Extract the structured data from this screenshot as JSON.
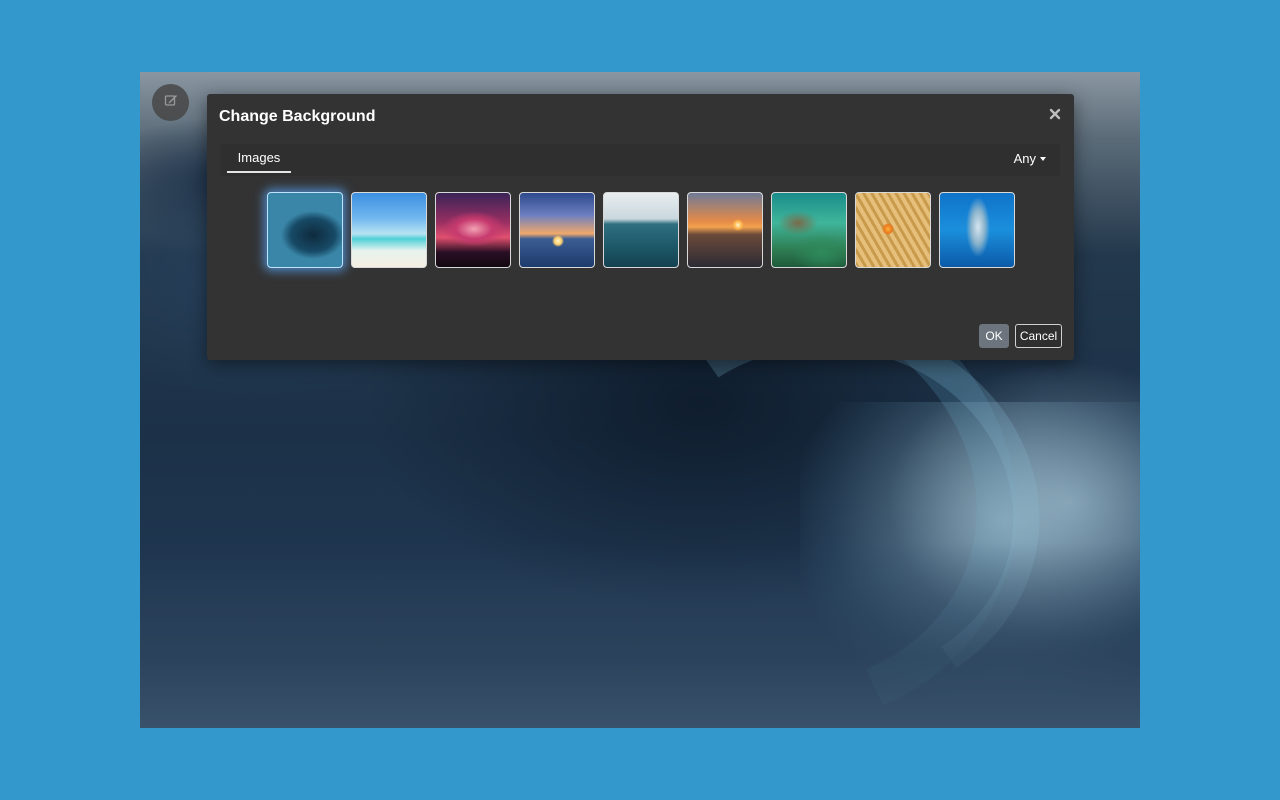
{
  "dialog": {
    "title": "Change Background",
    "tabs": [
      {
        "label": "Images",
        "active": true
      }
    ],
    "filter": {
      "label": "Any"
    },
    "thumbnails": [
      {
        "name": "ocean-wave-thumb",
        "selected": true
      },
      {
        "name": "tropical-beach-thumb",
        "selected": false
      },
      {
        "name": "tree-sunset-thumb",
        "selected": false
      },
      {
        "name": "ocean-sunset-thumb",
        "selected": false
      },
      {
        "name": "calm-sea-thumb",
        "selected": false
      },
      {
        "name": "golden-sunset-thumb",
        "selected": false
      },
      {
        "name": "coral-reef-thumb",
        "selected": false
      },
      {
        "name": "clownfish-anemone-thumb",
        "selected": false
      },
      {
        "name": "dolphin-thumb",
        "selected": false
      }
    ],
    "ok_label": "OK",
    "cancel_label": "Cancel"
  },
  "icons": {
    "edit": "edit-background-icon",
    "close": "close-icon",
    "caret": "caret-down-icon"
  },
  "colors": {
    "page_bg": "#3398cc",
    "dialog_bg": "#333333",
    "ok_button": "#6c757d",
    "selection_glow": "#5aaaff"
  }
}
